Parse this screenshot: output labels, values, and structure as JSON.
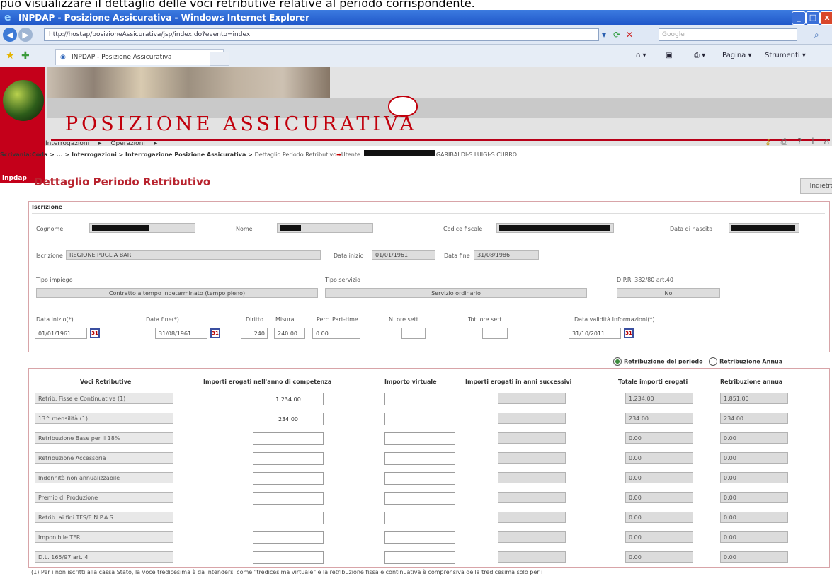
{
  "caption": "può visualizzare il dettaglio delle voci retributive relative al periodo corrispondente.",
  "window": {
    "title": "INPDAP - Posizione Assicurativa - Windows Internet Explorer"
  },
  "browser": {
    "address": "http://hostap/posizioneAssicurativa/jsp/index.do?evento=index",
    "search_placeholder": "Google",
    "tab_label": "INPDAP - Posizione Assicurativa",
    "cmd_page": "Pagina",
    "cmd_tools": "Strumenti"
  },
  "header": {
    "brand": "inpdap",
    "app_title": "POSIZIONE ASSICURATIVA",
    "menu": [
      "Interrogazioni",
      "Operazioni"
    ]
  },
  "breadcrumb": {
    "path": "Scrivania:Coda > ... > Interrogazioni > Interrogazione Posizione Assicurativa > ",
    "current": "Dettaglio Periodo Retributivo",
    "user_label": "Utente:",
    "org": "- AZIENDA OSPEDALIERA GARIBALDI-S.LUIGI-S CURRO"
  },
  "page": {
    "title": "Dettaglio Periodo Retributivo",
    "back": "Indietro"
  },
  "iscrizione": {
    "section": "Iscrizione",
    "cognome_lbl": "Cognome",
    "nome_lbl": "Nome",
    "cf_lbl": "Codice fiscale",
    "nascita_lbl": "Data di nascita",
    "iscr_lbl": "Iscrizione",
    "iscr_val": "REGIONE PUGLIA        BARI",
    "data_inizio_lbl": "Data inizio",
    "data_inizio_val": "01/01/1961",
    "data_fine_lbl": "Data fine",
    "data_fine_val": "31/08/1986",
    "tipo_impiego_lbl": "Tipo impiego",
    "tipo_impiego_val": "Contratto a tempo indeterminato (tempo pieno)",
    "tipo_servizio_lbl": "Tipo servizio",
    "tipo_servizio_val": "Servizio ordinario",
    "dpr_lbl": "D.P.R. 382/80 art.40",
    "dpr_val": "No"
  },
  "periodo": {
    "data_inizio_lbl": "Data inizio(*)",
    "data_inizio_val": "01/01/1961",
    "data_fine_lbl": "Data fine(*)",
    "data_fine_val": "31/08/1961",
    "diritto_lbl": "Diritto",
    "diritto_val": "240",
    "misura_lbl": "Misura",
    "misura_val": "240.00",
    "perc_lbl": "Perc. Part-time",
    "perc_val": "0.00",
    "ore_lbl": "N. ore sett.",
    "tot_ore_lbl": "Tot. ore sett.",
    "validita_lbl": "Data validità Informazioni(*)",
    "validita_val": "31/10/2011",
    "cal_icon": "calendar-icon"
  },
  "radios": {
    "opt1": "Retribuzione del periodo",
    "opt2": "Retribuzione Annua"
  },
  "table": {
    "headers": [
      "Voci Retributive",
      "Importi erogati nell'anno di competenza",
      "Importo virtuale",
      "Importi erogati in anni successivi",
      "Totale importi erogati",
      "Retribuzione annua"
    ],
    "rows": [
      {
        "voce": "Retrib. Fisse e Continuative (1)",
        "competenza": "1.234.00",
        "totale": "1.234.00",
        "annua": "1.851.00"
      },
      {
        "voce": "13^ mensilità (1)",
        "competenza": "234.00",
        "totale": "234.00",
        "annua": "234.00"
      },
      {
        "voce": "Retribuzione Base per il 18%",
        "competenza": "",
        "totale": "0.00",
        "annua": "0.00"
      },
      {
        "voce": "Retribuzione Accessoria",
        "competenza": "",
        "totale": "0.00",
        "annua": "0.00"
      },
      {
        "voce": "Indennità non annualizzabile",
        "competenza": "",
        "totale": "0.00",
        "annua": "0.00"
      },
      {
        "voce": "Premio di Produzione",
        "competenza": "",
        "totale": "0.00",
        "annua": "0.00"
      },
      {
        "voce": "Retrib. ai fini TFS/E.N.P.A.S.",
        "competenza": "",
        "totale": "0.00",
        "annua": "0.00"
      },
      {
        "voce": "Imponibile TFR",
        "competenza": "",
        "totale": "0.00",
        "annua": "0.00"
      },
      {
        "voce": "D.L. 165/97 art. 4",
        "competenza": "",
        "totale": "0.00",
        "annua": "0.00"
      }
    ]
  },
  "footnote": "(1) Per i non iscritti alla cassa Stato, la voce tredicesima è da intendersi come \"tredicesima virtuale\" e la retribuzione fissa e continuativa è comprensiva della tredicesima solo per i"
}
